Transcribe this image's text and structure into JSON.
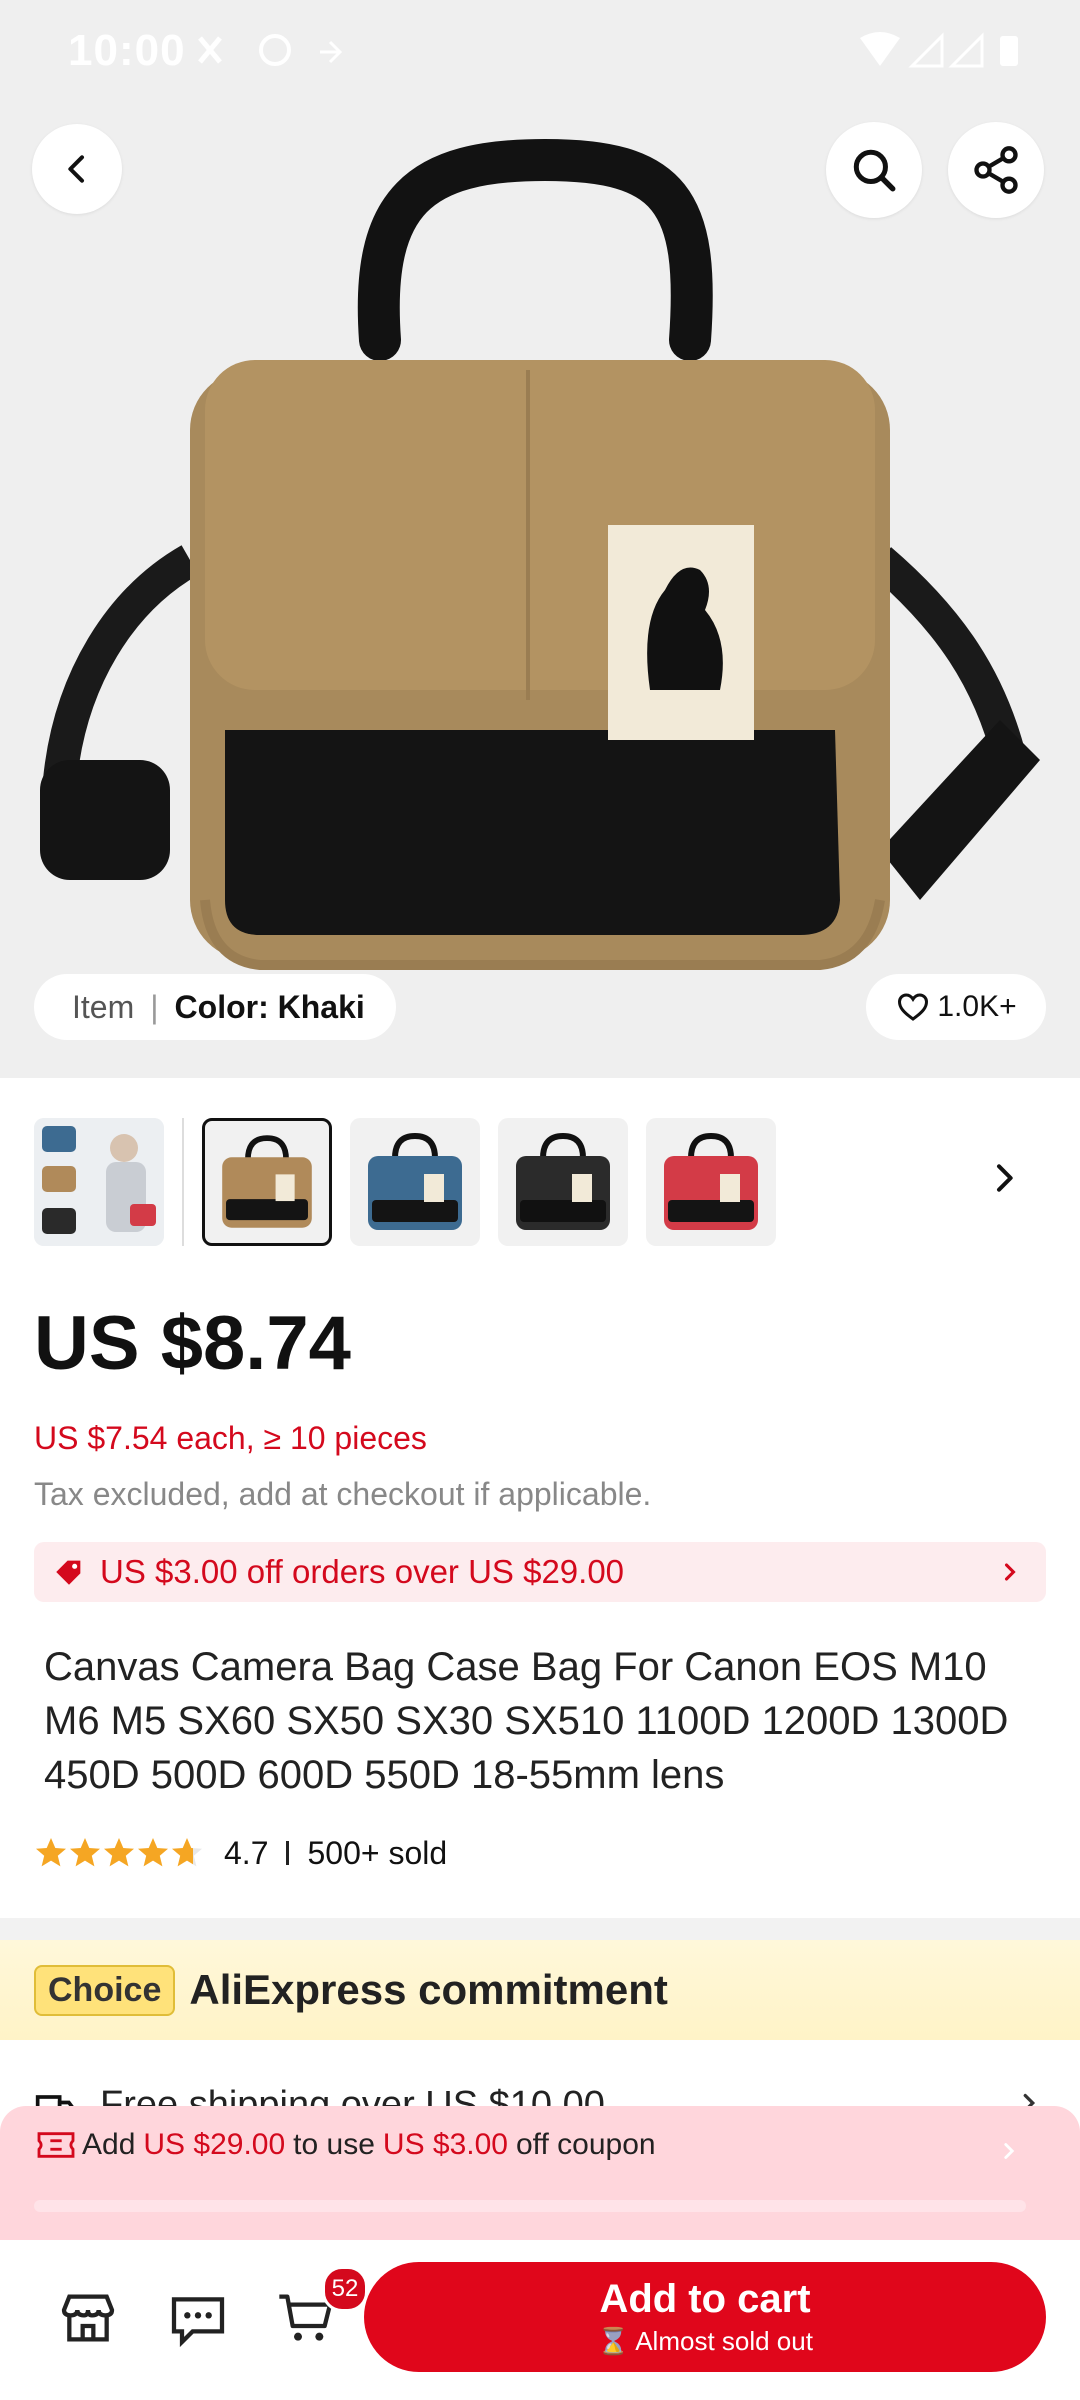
{
  "status_bar": {
    "time": "10:00"
  },
  "hero": {
    "chip_item": "Item",
    "chip_sep": "|",
    "chip_color": "Color: Khaki",
    "wishlist_count": "1.0K+"
  },
  "thumbnails": [
    {
      "name": "overview",
      "colors": [
        "#3d6b91",
        "#b08a5a",
        "#2a2a2a",
        "#d33b47"
      ]
    },
    {
      "name": "khaki",
      "color": "#b08a5a",
      "selected": true
    },
    {
      "name": "blue",
      "color": "#3d6b91"
    },
    {
      "name": "black",
      "color": "#2b2b2b"
    },
    {
      "name": "red",
      "color": "#d33b47"
    }
  ],
  "price": {
    "main": "US $8.74",
    "bulk": "US $7.54 each, ≥ 10 pieces",
    "tax_note": "Tax excluded, add at checkout if applicable."
  },
  "coupon": {
    "text": "US $3.00 off orders over US $29.00"
  },
  "product": {
    "title": "Canvas Camera Bag Case Bag For Canon EOS M10 M6 M5 SX60 SX50 SX30 SX510 1100D 1200D 1300D 450D 500D 600D 550D 18-55mm lens",
    "rating": "4.7",
    "rating_stars": 4.7,
    "sold": "500+ sold"
  },
  "choice": {
    "badge": "Choice",
    "label": "AliExpress commitment",
    "shipping_text": "Free shipping over US $10.00"
  },
  "add_banner": {
    "prefix": "Add",
    "amount": "US $29.00",
    "mid": "to use",
    "discount": "US $3.00",
    "suffix": "off coupon",
    "progress": 0
  },
  "bottom_bar": {
    "cart_count": "52",
    "add_to_cart": "Add to cart",
    "stock_note": "Almost sold out"
  },
  "colors": {
    "accent_red": "#e0061b",
    "price_red": "#d4091d",
    "star": "#f5a623"
  }
}
